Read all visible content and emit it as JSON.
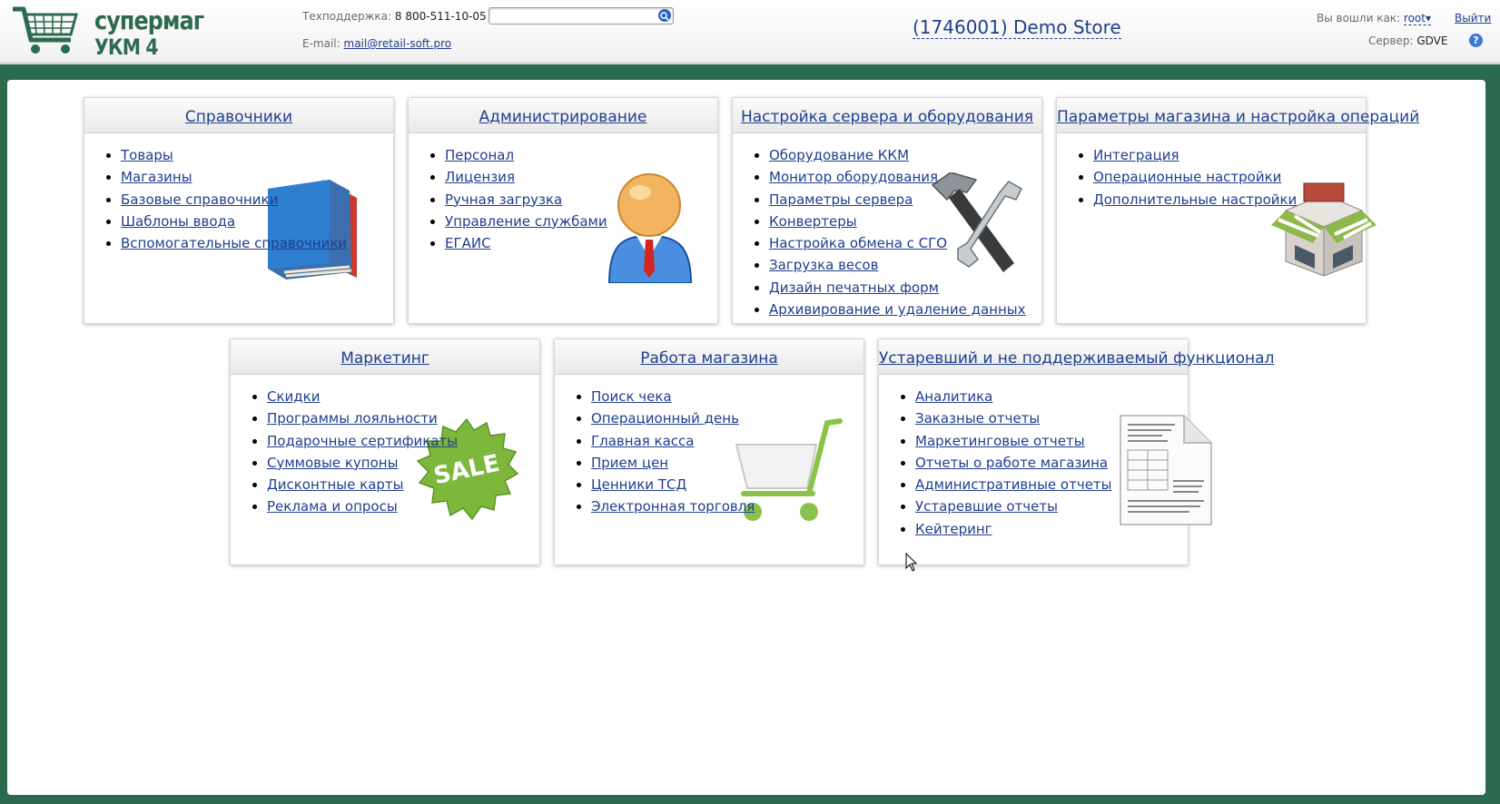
{
  "header": {
    "logo_line1": "супермаг",
    "logo_line2": "УКМ 4",
    "support_label": "Техподдержка:",
    "support_phone": "8 800-511-10-05",
    "email_label": "E-mail:",
    "email_value": "mail@retail-soft.pro",
    "search_value": "",
    "store_name": "(1746001) Demo Store",
    "user_label": "Вы вошли как:",
    "user_name": "root",
    "logout_label": "Выйти",
    "server_label": "Сервер:",
    "server_value": "GDVE"
  },
  "panels": [
    {
      "title": "Справочники",
      "items": [
        "Товары",
        "Магазины",
        "Базовые справочники",
        "Шаблоны ввода",
        "Вспомогательные справочники"
      ]
    },
    {
      "title": "Администрирование",
      "items": [
        "Персонал",
        "Лицензия",
        "Ручная загрузка",
        "Управление службами",
        "ЕГАИС"
      ]
    },
    {
      "title": "Настройка сервера и оборудования",
      "items": [
        "Оборудование ККМ",
        "Монитор оборудования",
        "Параметры сервера",
        "Конвертеры",
        "Настройка обмена с СГО",
        "Загрузка весов",
        "Дизайн печатных форм",
        "Архивирование и удаление данных"
      ]
    },
    {
      "title": "Параметры магазина и настройка операций",
      "items": [
        "Интеграция",
        "Операционные настройки",
        "Дополнительные настройки"
      ]
    },
    {
      "title": "Маркетинг",
      "items": [
        "Скидки",
        "Программы лояльности",
        "Подарочные сертификаты",
        "Суммовые купоны",
        "Дисконтные карты",
        "Реклама и опросы"
      ]
    },
    {
      "title": "Работа магазина",
      "items": [
        "Поиск чека",
        "Операционный день",
        "Главная касса",
        "Прием цен",
        "Ценники ТСД",
        "Электронная торговля"
      ]
    },
    {
      "title": "Устаревший и не поддерживаемый функционал",
      "items": [
        "Аналитика",
        "Заказные отчеты",
        "Маркетинговые отчеты",
        "Отчеты о работе магазина",
        "Административные отчеты",
        "Устаревшие отчеты",
        "Кейтеринг"
      ]
    }
  ],
  "sale_label": "SALE",
  "icons": {
    "logo": "cart-logo-icon",
    "search": "search-icon",
    "help": "help-icon",
    "panel_art": [
      "books-icon",
      "user-icon",
      "tools-icon",
      "shop-icon",
      "sale-icon",
      "cart-icon",
      "report-icon"
    ]
  },
  "colors": {
    "brand": "#2d6a4f",
    "link": "#1f3e8e",
    "background": "#2b6a4e"
  }
}
